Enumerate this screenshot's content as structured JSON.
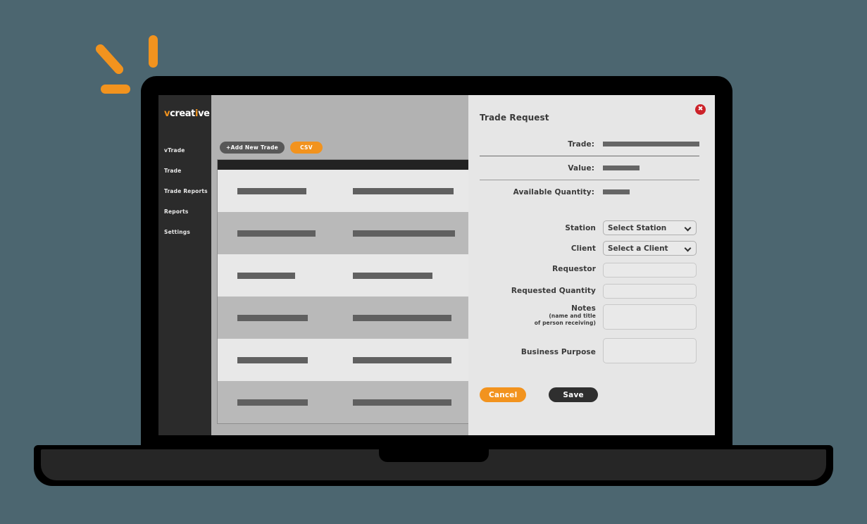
{
  "theme": {
    "background": "#4c6670",
    "accent_orange": "#f2931e",
    "sidebar_bg": "#2b2b2b",
    "modal_bg": "#e6e6e6",
    "close_red": "#cc2229",
    "dark_button": "#2f2f2f"
  },
  "decor": {
    "spark_vertical": "spark-vertical-mark",
    "spark_diagonal": "spark-diagonal-mark",
    "spark_horizontal": "spark-horizontal-mark"
  },
  "sidebar": {
    "logo": {
      "v": "v",
      "rest_before_dot": "creat",
      "dot_letter": "i",
      "rest_after_dot": "ve",
      "full": "vcreative"
    },
    "items": [
      {
        "label": "vTrade"
      },
      {
        "label": "Trade"
      },
      {
        "label": "Trade Reports"
      },
      {
        "label": "Reports"
      },
      {
        "label": "Settings"
      }
    ]
  },
  "toolbar": {
    "add_new_trade_label": "+Add New Trade",
    "csv_label": "CSV"
  },
  "table": {
    "rows": [
      {
        "shade": "light",
        "bar1_width": 98,
        "bar2_width": 143
      },
      {
        "shade": "dark",
        "bar1_width": 111,
        "bar2_width": 145
      },
      {
        "shade": "light",
        "bar1_width": 82,
        "bar2_width": 113
      },
      {
        "shade": "dark",
        "bar1_width": 100,
        "bar2_width": 140
      },
      {
        "shade": "light",
        "bar1_width": 100,
        "bar2_width": 140
      },
      {
        "shade": "dark",
        "bar1_width": 100,
        "bar2_width": 140
      }
    ]
  },
  "modal": {
    "title": "Trade Request",
    "close_icon": "close-icon",
    "close_glyph": "✖",
    "readonly_fields": [
      {
        "label": "Trade:",
        "value_bar_width": 155
      },
      {
        "label": "Value:",
        "value_bar_width": 52
      },
      {
        "label": "Available Quantity:",
        "value_bar_width": 38
      }
    ],
    "form_fields": [
      {
        "key": "station",
        "label": "Station",
        "type": "select",
        "selected": "Select Station",
        "options": [
          "Select Station"
        ]
      },
      {
        "key": "client",
        "label": "Client",
        "type": "select",
        "selected": "Select a Client",
        "options": [
          "Select a Client"
        ]
      },
      {
        "key": "requestor",
        "label": "Requestor",
        "type": "text",
        "value": "",
        "placeholder": ""
      },
      {
        "key": "requested_quantity",
        "label": "Requested Quantity",
        "type": "text",
        "value": "",
        "placeholder": ""
      },
      {
        "key": "notes",
        "label": "Notes",
        "sub_label_line1": "(name and title",
        "sub_label_line2": "of person receiving)",
        "type": "textarea",
        "value": "",
        "placeholder": ""
      },
      {
        "key": "business_purpose",
        "label": "Business Purpose",
        "type": "textarea",
        "value": "",
        "placeholder": ""
      }
    ],
    "actions": {
      "cancel_label": "Cancel",
      "save_label": "Save"
    }
  }
}
